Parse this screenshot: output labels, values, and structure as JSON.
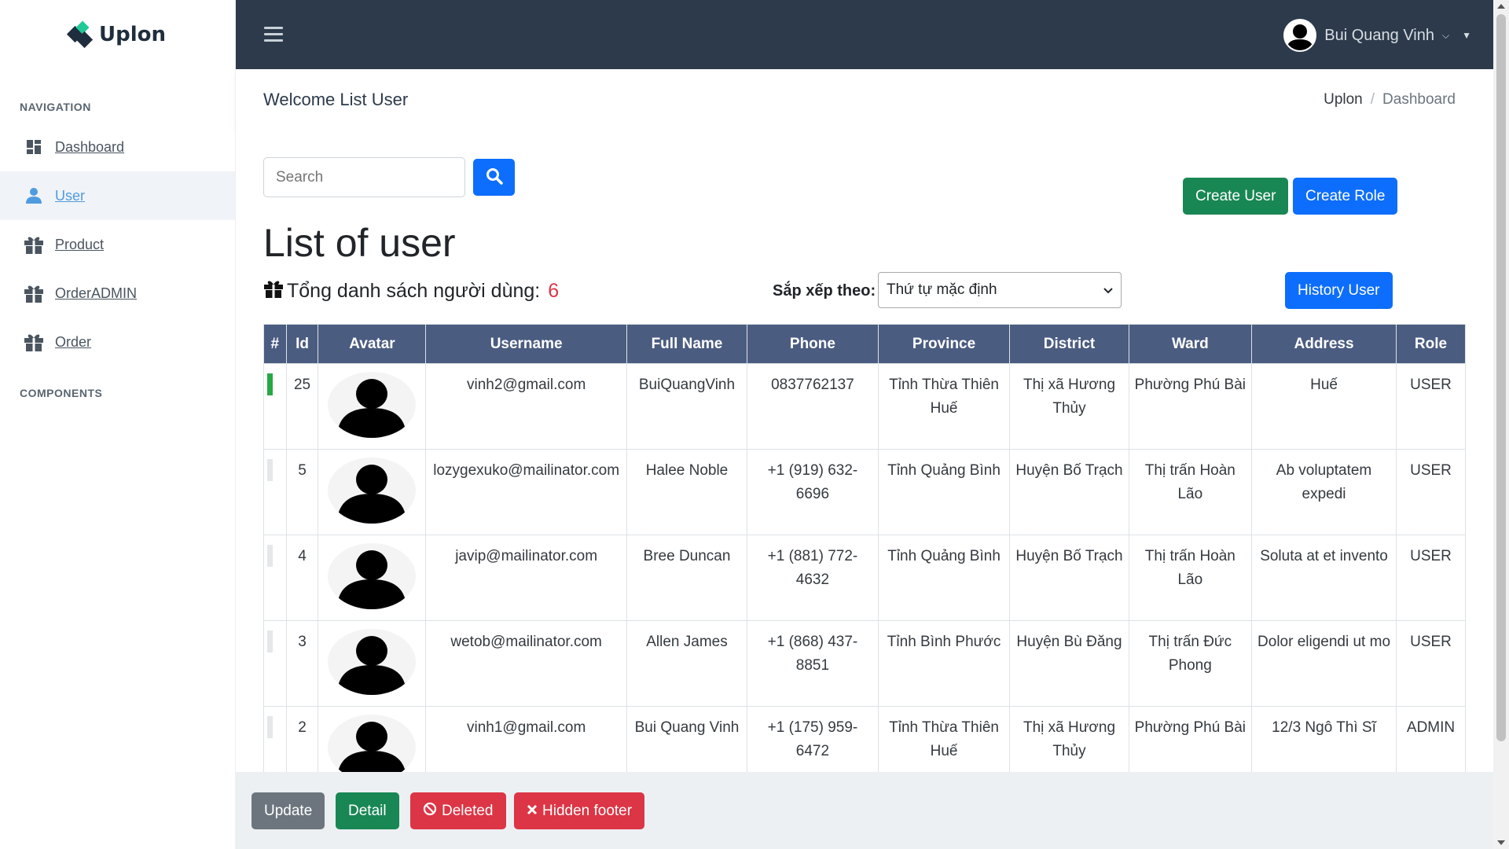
{
  "app": {
    "logo": "Uplon"
  },
  "sidebar": {
    "navigation_title": "NAVIGATION",
    "components_title": "COMPONENTS",
    "items": [
      {
        "label": "Dashboard",
        "icon": "dashboard-icon"
      },
      {
        "label": "User",
        "icon": "user-icon"
      },
      {
        "label": "Product",
        "icon": "gift-icon"
      },
      {
        "label": "OrderADMIN",
        "icon": "gift-icon"
      },
      {
        "label": "Order",
        "icon": "gift-icon"
      }
    ]
  },
  "topbar": {
    "username": "Bui Quang Vinh"
  },
  "header": {
    "title": "Welcome List User",
    "breadcrumb": [
      "Uplon",
      "Dashboard"
    ]
  },
  "main": {
    "search_placeholder": "Search",
    "heading": "List of user",
    "create_user": "Create User",
    "create_role": "Create Role",
    "history_user": "History User",
    "total_label": "Tổng danh sách người dùng:",
    "total_count": "6",
    "sort_label": "Sắp xếp theo:",
    "sort_value": "Thứ tự mặc định",
    "columns": [
      "#",
      "Id",
      "Avatar",
      "Username",
      "Full Name",
      "Phone",
      "Province",
      "District",
      "Ward",
      "Address",
      "Role"
    ],
    "rows": [
      {
        "id": "25",
        "username": "vinh2@gmail.com",
        "full_name": "BuiQuangVinh",
        "phone": "0837762137",
        "province": "Tỉnh Thừa Thiên Huế",
        "district": "Thị xã Hương Thủy",
        "ward": "Phường Phú Bài",
        "address": "Huế",
        "role": "USER",
        "selected": true
      },
      {
        "id": "5",
        "username": "lozygexuko@mailinator.com",
        "full_name": "Halee Noble",
        "phone": "+1 (919) 632-6696",
        "province": "Tỉnh Quảng Bình",
        "district": "Huyện Bố Trạch",
        "ward": "Thị trấn Hoàn Lão",
        "address": "Ab voluptatem expedi",
        "role": "USER",
        "selected": false
      },
      {
        "id": "4",
        "username": "javip@mailinator.com",
        "full_name": "Bree Duncan",
        "phone": "+1 (881) 772-4632",
        "province": "Tỉnh Quảng Bình",
        "district": "Huyện Bố Trạch",
        "ward": "Thị trấn Hoàn Lão",
        "address": "Soluta at et invento",
        "role": "USER",
        "selected": false
      },
      {
        "id": "3",
        "username": "wetob@mailinator.com",
        "full_name": "Allen James",
        "phone": "+1 (868) 437-8851",
        "province": "Tỉnh Bình Phước",
        "district": "Huyện Bù Đăng",
        "ward": "Thị trấn Đức Phong",
        "address": "Dolor eligendi ut mo",
        "role": "USER",
        "selected": false
      },
      {
        "id": "2",
        "username": "vinh1@gmail.com",
        "full_name": "Bui Quang Vinh",
        "phone": "+1 (175) 959-6472",
        "province": "Tỉnh Thừa Thiên Huế",
        "district": "Thị xã Hương Thủy",
        "ward": "Phường Phú Bài",
        "address": "12/3 Ngô Thì Sĩ",
        "role": "ADMIN",
        "selected": false
      }
    ]
  },
  "footer": {
    "update": "Update",
    "detail": "Detail",
    "deleted": "Deleted",
    "hidden_footer": "Hidden footer"
  },
  "colors": {
    "topbar": "#2c3a4b",
    "table_header": "#4b5c81",
    "primary": "#0d6efd",
    "success": "#198754",
    "danger": "#dc3545"
  }
}
